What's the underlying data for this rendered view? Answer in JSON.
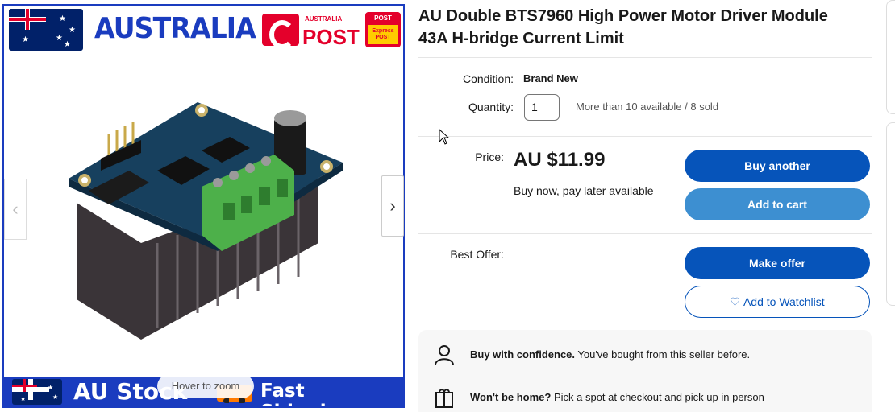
{
  "gallery": {
    "banner_top_text": "AUSTRALIA",
    "post_small": "AUSTRALIA",
    "post_big": "POST",
    "express_top": "POST",
    "express_mid": "Express POST",
    "banner_bottom_left": "AU Stock",
    "banner_bottom_right": "Fast Shipping",
    "hover_zoom": "Hover to zoom",
    "prev_arrow": "‹",
    "next_arrow": "›"
  },
  "listing": {
    "title": "AU Double BTS7960 High Power Motor Driver Module 43A H-bridge Current Limit",
    "condition_label": "Condition:",
    "condition_value": "Brand New",
    "quantity_label": "Quantity:",
    "quantity_value": "1",
    "availability": "More than 10 available / 8 sold",
    "price_label": "Price:",
    "price": "AU $11.99",
    "pay_later": "Buy now, pay later available",
    "best_offer_label": "Best Offer:"
  },
  "buttons": {
    "buy_another": "Buy another",
    "add_to_cart": "Add to cart",
    "make_offer": "Make offer",
    "add_to_watchlist": "Add to Watchlist"
  },
  "confidence": {
    "row1_bold": "Buy with confidence.",
    "row1_text": " You've bought from this seller before.",
    "row2_bold": "Won't be home?",
    "row2_text": " Pick a spot at checkout and pick up in person"
  },
  "colors": {
    "primary_button": "#0654ba",
    "secondary_button": "#3d8fd1",
    "banner_blue": "#1a3cbf",
    "post_red": "#e4002b"
  },
  "icons": [
    "flag-icon",
    "auspost-logo",
    "express-post-logo",
    "truck-icon",
    "chevron-left-icon",
    "chevron-right-icon",
    "heart-icon",
    "person-icon",
    "package-icon",
    "mouse-cursor-icon"
  ]
}
